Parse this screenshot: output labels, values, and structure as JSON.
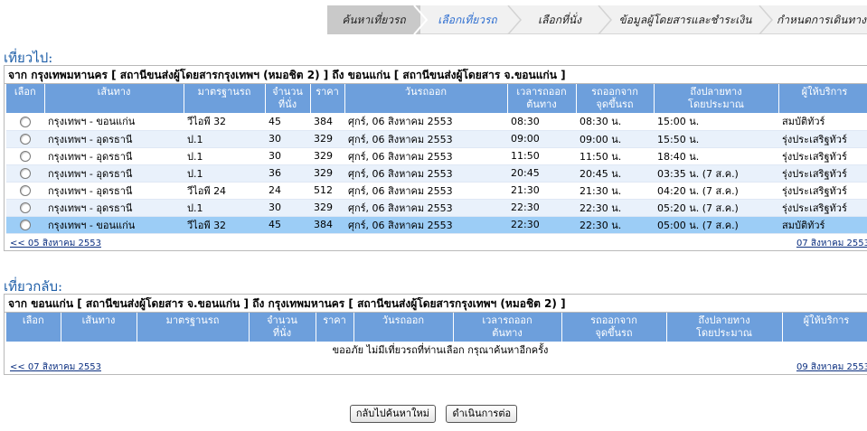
{
  "steps": [
    {
      "label": "ค้นหาเที่ยวรถ",
      "state": "done"
    },
    {
      "label": "เลือกเที่ยวรถ",
      "state": "active"
    },
    {
      "label": "เลือกที่นั่ง",
      "state": "todo"
    },
    {
      "label": "ข้อมูลผู้โดยสารและชำระเงิน",
      "state": "todo"
    },
    {
      "label": "กำหนดการเดินทาง",
      "state": "todo"
    }
  ],
  "outbound": {
    "title": "เที่ยวไป:",
    "route": "จาก กรุงเทพมหานคร [ สถานีขนส่งผู้โดยสารกรุงเทพฯ (หมอชิต 2) ] ถึง ขอนแก่น [ สถานีขนส่งผู้โดยสาร จ.ขอนแก่น ]",
    "headers": [
      "เลือก",
      "เส้นทาง",
      "มาตรฐานรถ",
      "จำนวน\nที่นั่ง",
      "ราคา",
      "วันรถออก",
      "เวลารถออก\nต้นทาง",
      "รถออกจาก\nจุดขึ้นรถ",
      "ถึงปลายทาง\nโดยประมาณ",
      "ผู้ให้บริการ"
    ],
    "rows": [
      [
        "กรุงเทพฯ - ขอนแก่น",
        "วีไอพี 32",
        "45",
        "384",
        "ศุกร์, 06 สิงหาคม 2553",
        "08:30",
        "08:30 น.",
        "15:00 น.",
        "สมบัติทัวร์"
      ],
      [
        "กรุงเทพฯ - อุดรธานี",
        "ป.1",
        "30",
        "329",
        "ศุกร์, 06 สิงหาคม 2553",
        "09:00",
        "09:00 น.",
        "15:50 น.",
        "รุ่งประเสริฐทัวร์"
      ],
      [
        "กรุงเทพฯ - อุดรธานี",
        "ป.1",
        "30",
        "329",
        "ศุกร์, 06 สิงหาคม 2553",
        "11:50",
        "11:50 น.",
        "18:40 น.",
        "รุ่งประเสริฐทัวร์"
      ],
      [
        "กรุงเทพฯ - อุดรธานี",
        "ป.1",
        "36",
        "329",
        "ศุกร์, 06 สิงหาคม 2553",
        "20:45",
        "20:45 น.",
        "03:35 น. (7 ส.ค.)",
        "รุ่งประเสริฐทัวร์"
      ],
      [
        "กรุงเทพฯ - อุดรธานี",
        "วีไอพี 24",
        "24",
        "512",
        "ศุกร์, 06 สิงหาคม 2553",
        "21:30",
        "21:30 น.",
        "04:20 น. (7 ส.ค.)",
        "รุ่งประเสริฐทัวร์"
      ],
      [
        "กรุงเทพฯ - อุดรธานี",
        "ป.1",
        "30",
        "329",
        "ศุกร์, 06 สิงหาคม 2553",
        "22:30",
        "22:30 น.",
        "05:20 น. (7 ส.ค.)",
        "รุ่งประเสริฐทัวร์"
      ],
      [
        "กรุงเทพฯ - ขอนแก่น",
        "วีไอพี 32",
        "45",
        "384",
        "ศุกร์, 06 สิงหาคม 2553",
        "22:30",
        "22:30 น.",
        "05:00 น. (7 ส.ค.)",
        "สมบัติทัวร์"
      ]
    ],
    "selected_row": 6,
    "prev_link": "<< 05 สิงหาคม 2553",
    "next_link": "07 สิงหาคม 2553"
  },
  "return": {
    "title": "เที่ยวกลับ:",
    "route": "จาก ขอนแก่น [ สถานีขนส่งผู้โดยสาร จ.ขอนแก่น ] ถึง กรุงเทพมหานคร [ สถานีขนส่งผู้โดยสารกรุงเทพฯ (หมอชิต 2) ]",
    "headers": [
      "เลือก",
      "เส้นทาง",
      "มาตรฐานรถ",
      "จำนวน\nที่นั่ง",
      "ราคา",
      "วันรถออก",
      "เวลารถออก\nต้นทาง",
      "รถออกจาก\nจุดขึ้นรถ",
      "ถึงปลายทาง\nโดยประมาณ",
      "ผู้ให้บริการ"
    ],
    "empty_message": "ขออภัย ไม่มีเที่ยวรถที่ท่านเลือก กรุณาค้นหาอีกครั้ง",
    "prev_link": "<< 07 สิงหาคม 2553",
    "next_link": "09 สิงหาคม 2553"
  },
  "buttons": {
    "back_label": "กลับไปค้นหาใหม่",
    "continue_label": "ดำเนินการต่อ"
  },
  "colors": {
    "header_bg": "#6d9fdc",
    "row_alt": "#e9f1fb",
    "row_selected": "#9ccdf6",
    "title_color": "#1f5fa8",
    "active_step": "#2f6fd0"
  }
}
